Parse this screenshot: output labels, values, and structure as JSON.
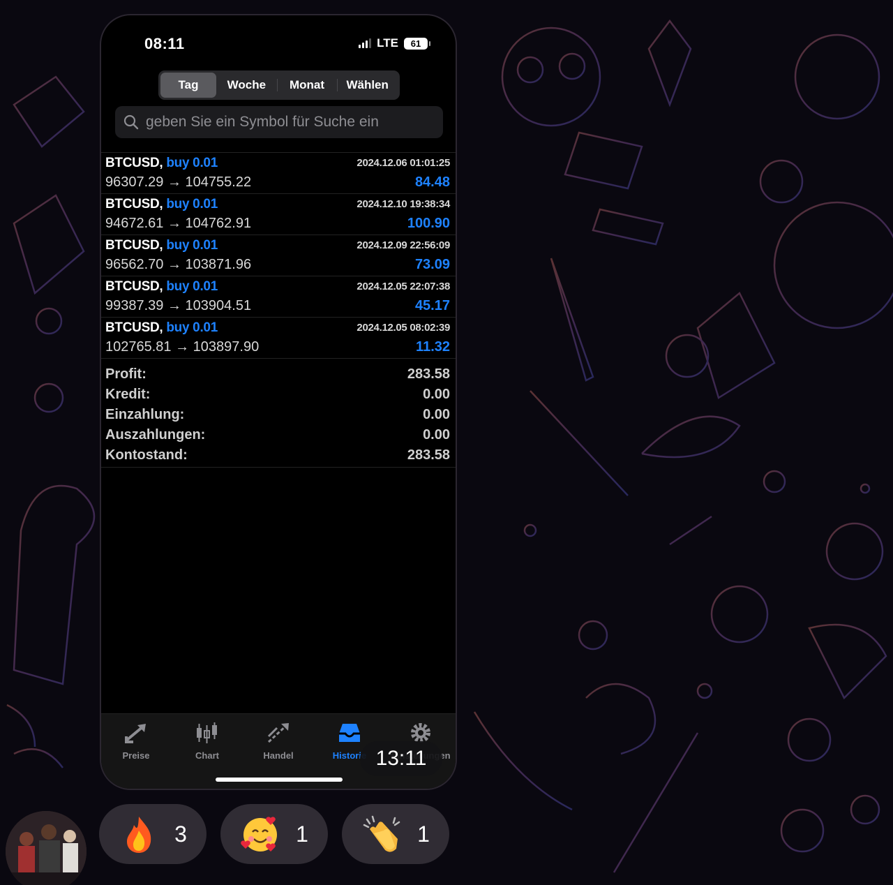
{
  "status_bar": {
    "time": "08:11",
    "network": "LTE",
    "battery": "61"
  },
  "period_tabs": [
    "Tag",
    "Woche",
    "Monat",
    "Wählen"
  ],
  "search": {
    "placeholder": "geben Sie ein Symbol für Suche ein"
  },
  "trades": [
    {
      "symbol": "BTCUSD,",
      "side": "buy 0.01",
      "date": "2024.12.06 01:01:25",
      "prices": "96307.29 → 104755.22",
      "profit": "84.48"
    },
    {
      "symbol": "BTCUSD,",
      "side": "buy 0.01",
      "date": "2024.12.10 19:38:34",
      "prices": "94672.61 → 104762.91",
      "profit": "100.90"
    },
    {
      "symbol": "BTCUSD,",
      "side": "buy 0.01",
      "date": "2024.12.09 22:56:09",
      "prices": "96562.70 → 103871.96",
      "profit": "73.09"
    },
    {
      "symbol": "BTCUSD,",
      "side": "buy 0.01",
      "date": "2024.12.05 22:07:38",
      "prices": "99387.39 → 103904.51",
      "profit": "45.17"
    },
    {
      "symbol": "BTCUSD,",
      "side": "buy 0.01",
      "date": "2024.12.05 08:02:39",
      "prices": "102765.81 → 103897.90",
      "profit": "11.32"
    }
  ],
  "summary": [
    {
      "label": "Profit:",
      "value": "283.58"
    },
    {
      "label": "Kredit:",
      "value": "0.00"
    },
    {
      "label": "Einzahlung:",
      "value": "0.00"
    },
    {
      "label": "Auszahlungen:",
      "value": "0.00"
    },
    {
      "label": "Kontostand:",
      "value": "283.58"
    }
  ],
  "bottom_tabs": [
    {
      "label": "Preise",
      "icon": "prices-arrows-icon"
    },
    {
      "label": "Chart",
      "icon": "candlestick-icon"
    },
    {
      "label": "Handel",
      "icon": "trade-icon"
    },
    {
      "label": "Historie",
      "icon": "inbox-icon"
    },
    {
      "label": "Einstellungen",
      "icon": "gear-icon"
    }
  ],
  "message_time": "13:11",
  "reactions": [
    {
      "emoji": "fire-emoji",
      "count": "3"
    },
    {
      "emoji": "smiling-face-with-hearts-emoji",
      "count": "1"
    },
    {
      "emoji": "clapping-hands-emoji",
      "count": "1"
    }
  ],
  "colors": {
    "accent": "#1e82ff",
    "background": "#000000"
  }
}
